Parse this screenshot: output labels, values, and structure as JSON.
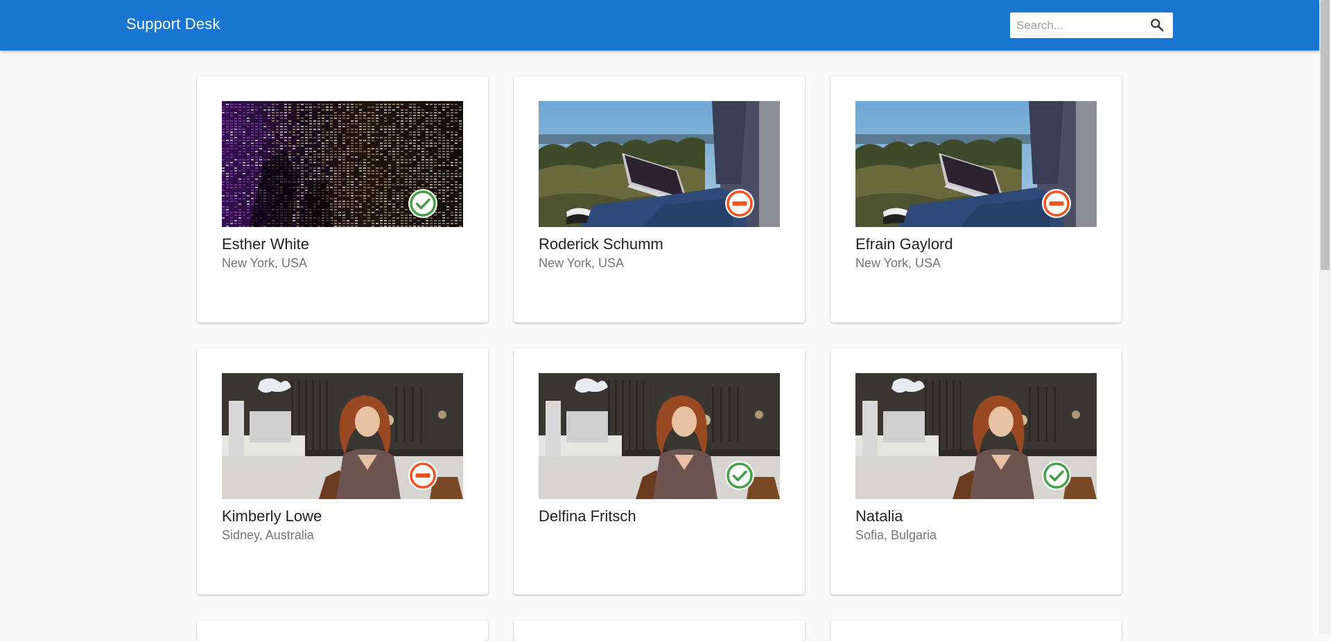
{
  "app": {
    "title": "Support Desk"
  },
  "search": {
    "placeholder": "Search..."
  },
  "cards": [
    {
      "name": "Esther White",
      "location": "New York, USA",
      "status": "online",
      "photo": "code-screen"
    },
    {
      "name": "Roderick Schumm",
      "location": "New York, USA",
      "status": "busy",
      "photo": "laptop-outdoors"
    },
    {
      "name": "Efrain Gaylord",
      "location": "New York, USA",
      "status": "busy",
      "photo": "laptop-outdoors"
    },
    {
      "name": "Kimberly Lowe",
      "location": "Sidney, Australia",
      "status": "busy",
      "photo": "woman-cafe"
    },
    {
      "name": "Delfina Fritsch",
      "location": "",
      "status": "online",
      "photo": "woman-cafe"
    },
    {
      "name": "Natalia",
      "location": "Sofia, Bulgaria",
      "status": "online",
      "photo": "woman-cafe"
    }
  ],
  "colors": {
    "app_bar": "#1976d2",
    "status_online": "#43a047",
    "status_busy": "#f4511e"
  },
  "icons": {
    "search": "search-icon",
    "online": "check-circle-icon",
    "busy": "do-not-disturb-icon"
  }
}
